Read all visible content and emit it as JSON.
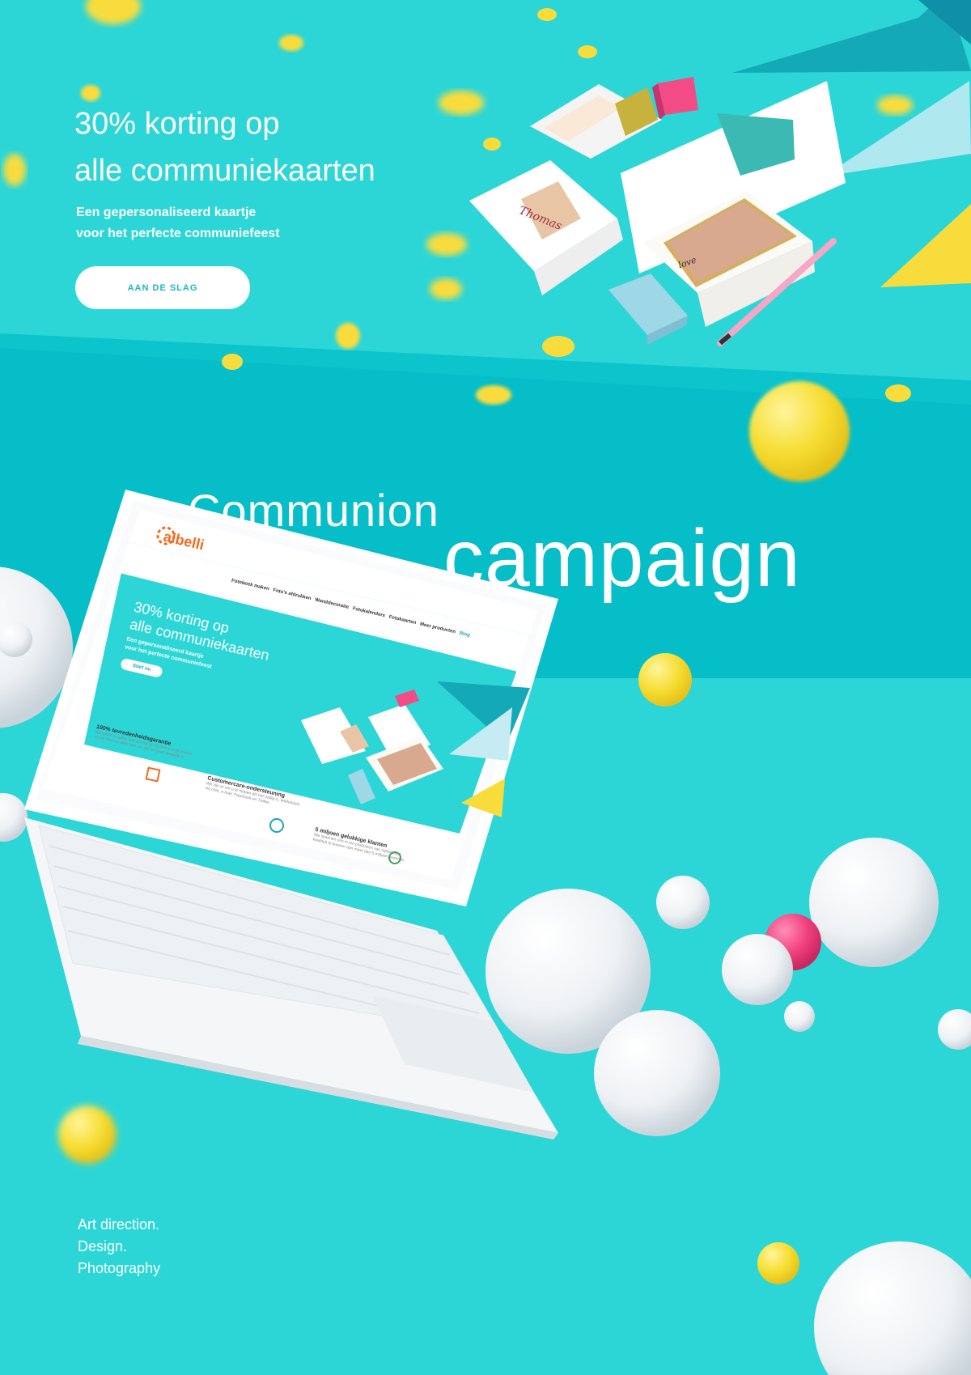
{
  "hero": {
    "title_line1": "30% korting op",
    "title_line2": "alle communiekaarten",
    "sub_line1": "Een gepersonaliseerd kaartje",
    "sub_line2": "voor het perfecte communiefeest",
    "cta_label": "AAN DE SLAG"
  },
  "campaign": {
    "word1": "Communion",
    "word2": "campaign"
  },
  "credits": {
    "line1": "Art direction.",
    "line2": "Design.",
    "line3": "Photography"
  },
  "laptop_site": {
    "logo_text": "albelli",
    "nav": [
      "Fotoboek maken",
      "Foto's afdrukken",
      "Wanddecoratie",
      "Fotokalenders",
      "Fotokaarten",
      "Meer producten",
      "Blog"
    ],
    "title_line1": "30% korting op",
    "title_line2": "alle communiekaarten",
    "sub_line1": "Een gepersonaliseerd kaartje",
    "sub_line2": "voor het perfecte communiefeest",
    "cta_label": "Start nu",
    "features": [
      {
        "title": "100% tevredenheidsgarantie",
        "text1": "We willen er zeker van zijn dat je blij bent met je creatie",
        "text2": "en we doen er alles aan om dat zo goed mogelijk te",
        "text3": "doen"
      },
      {
        "title": "Customercare-ondersteuning",
        "text1": "We zijn er om u te helpen als het nodig is, telefonisch,",
        "text2": "via chat, e-mail, Facebook en Twitter.",
        "text3": ""
      },
      {
        "title": "5 miljoen gelukkige klanten",
        "text1": "We spannen ons in om producten van topkwaliteit",
        "text2": "kwaliteit te leveren aan meer dan 5 miljoen tevreden",
        "text3": ""
      }
    ]
  },
  "card": {
    "name_script": "Thomas",
    "love_script": "love"
  },
  "colors": {
    "background": "#2dd6d6",
    "band": "#04bcc6",
    "accent_yellow": "#f8dc3c",
    "accent_pink": "#f24b86",
    "white": "#ffffff"
  }
}
